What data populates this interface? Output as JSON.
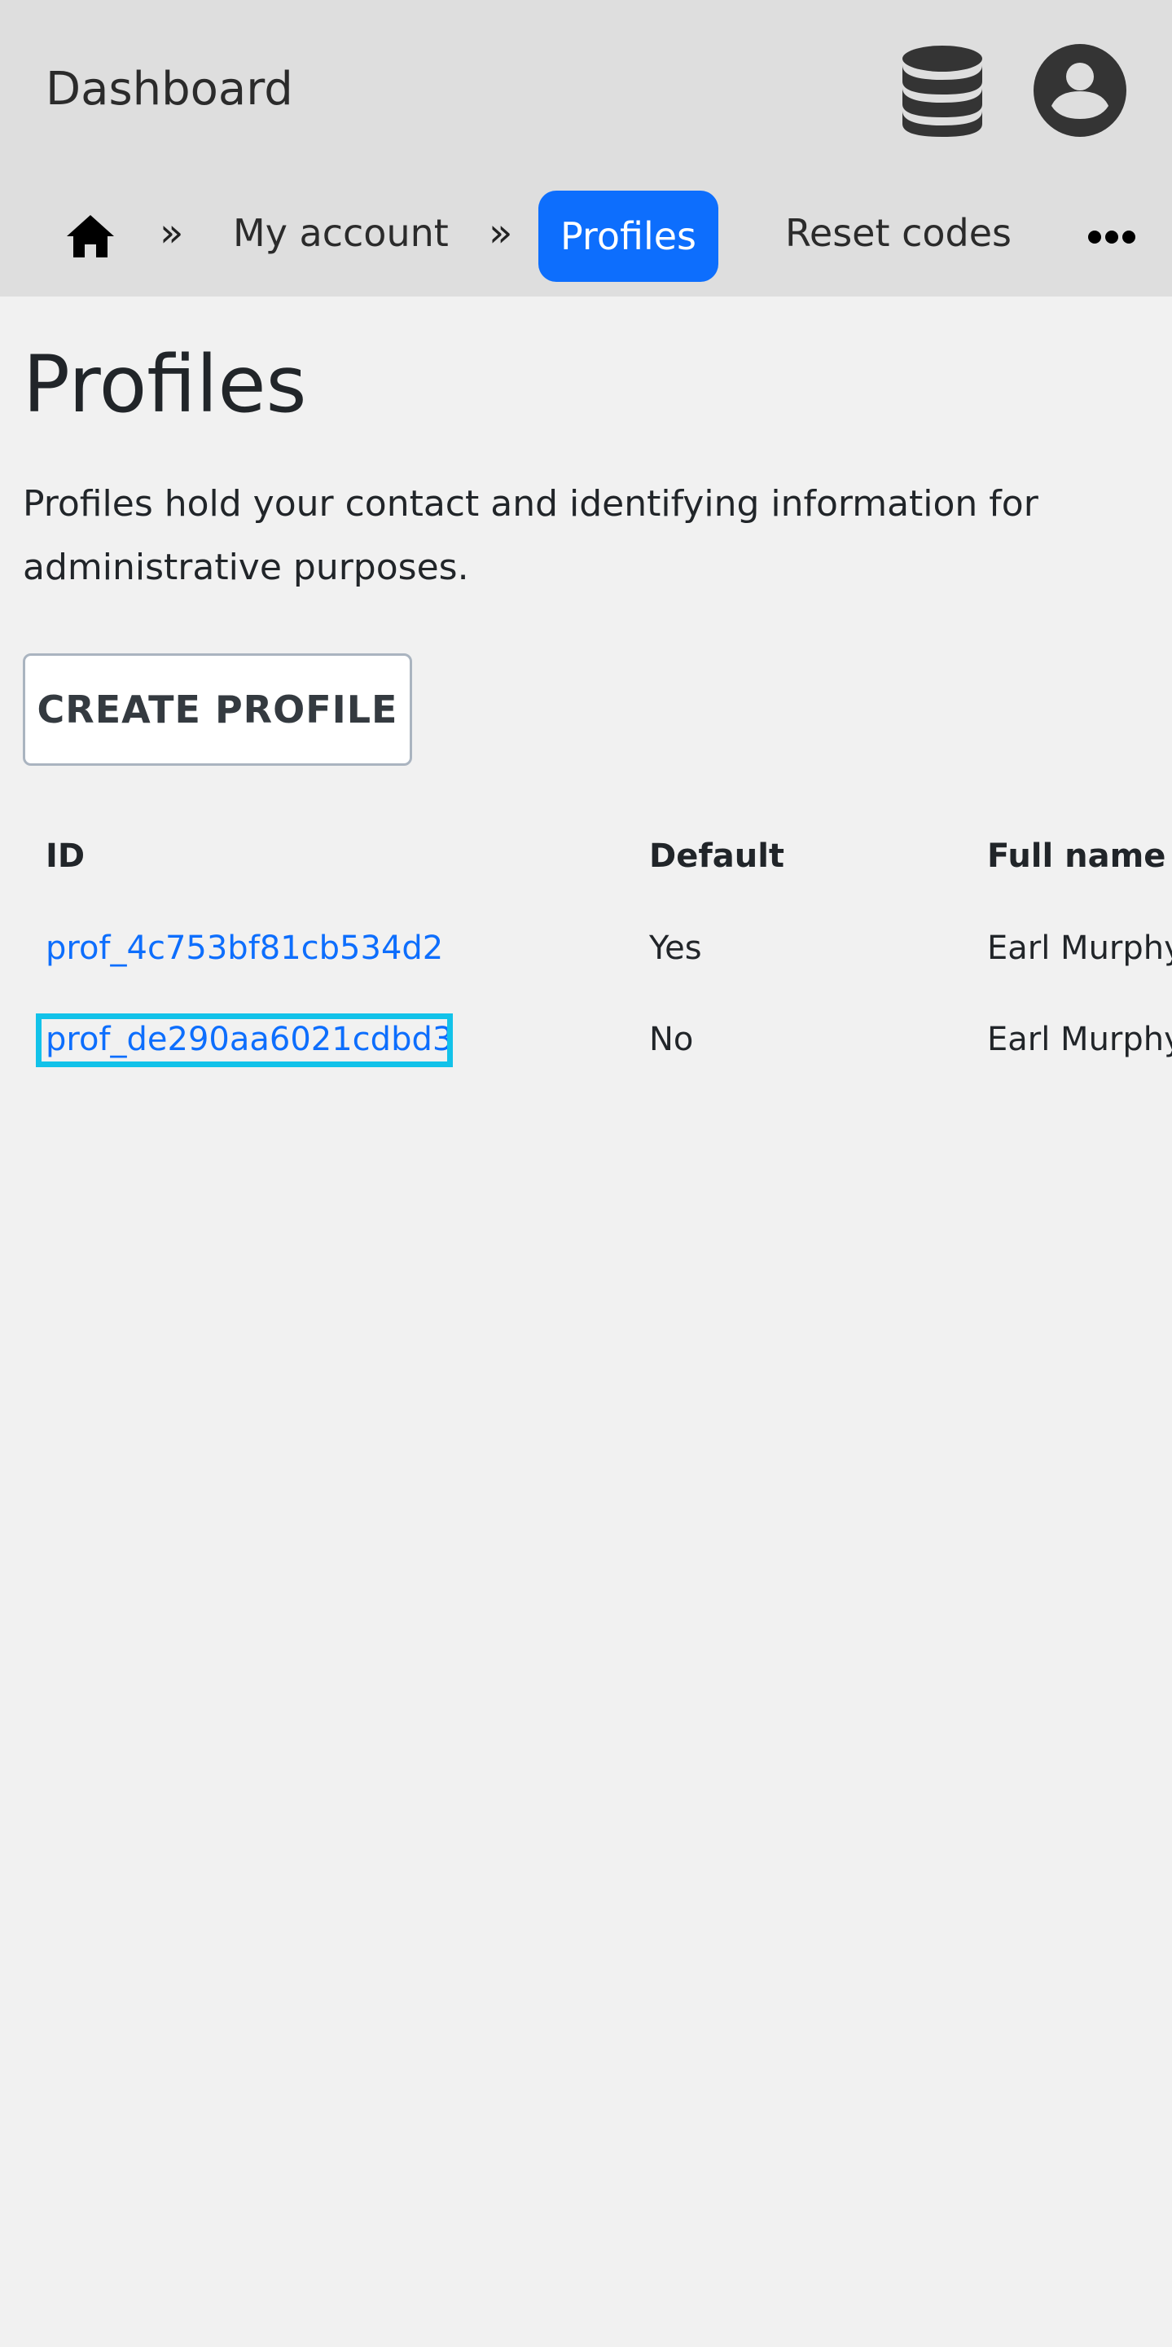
{
  "header": {
    "title": "Dashboard",
    "database_icon": "database-icon",
    "account_icon": "user-circle-icon"
  },
  "nav": {
    "home_icon": "home-icon",
    "separator": "»",
    "items": [
      {
        "label": "My account"
      },
      {
        "label": "Profiles",
        "active": true
      },
      {
        "label": "Reset codes"
      }
    ],
    "more_icon": "more-dots-icon",
    "active_color": "#0d6efd"
  },
  "main": {
    "title": "Profiles",
    "description": "Profiles hold your contact and identifying information for administrative purposes.",
    "create_button": "CREATE PROFILE"
  },
  "table": {
    "columns": [
      "ID",
      "Default",
      "Full name"
    ],
    "rows": [
      {
        "id": "prof_4c753bf81cb534d2",
        "default": "Yes",
        "full_name": "Earl Murphy"
      },
      {
        "id": "prof_de290aa6021cdbd3",
        "default": "No",
        "full_name": "Earl Murphy",
        "focused": true
      }
    ],
    "link_color": "#0d6efd",
    "focus_color": "#12c2e9"
  }
}
